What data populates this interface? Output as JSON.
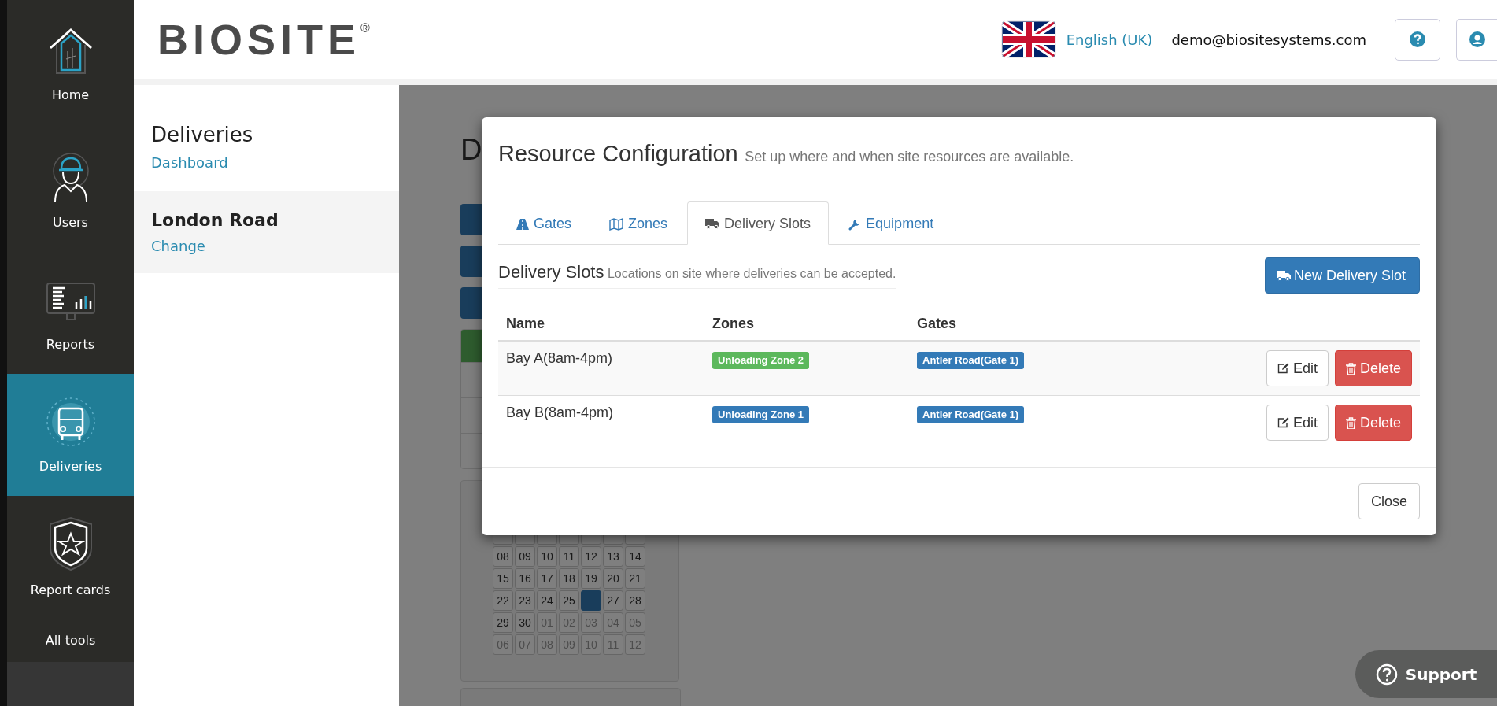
{
  "nav": [
    {
      "label": "Home",
      "selected": false
    },
    {
      "label": "Users",
      "selected": false
    },
    {
      "label": "Reports",
      "selected": false
    },
    {
      "label": "Deliveries",
      "selected": true
    },
    {
      "label": "Report cards",
      "selected": false
    },
    {
      "label": "All tools",
      "selected": false
    }
  ],
  "header": {
    "logo": "BIOSITE",
    "logo_mark": "®",
    "language": "English (UK)",
    "email": "demo@biositesystems.com"
  },
  "sidebar": {
    "title": "Deliveries",
    "link": "Dashboard",
    "site": "London Road",
    "site_link": "Change"
  },
  "background_page": {
    "heading": "D",
    "calendar_rows": [
      [
        {
          "selected": false
        },
        {
          "selected": false
        },
        {
          "selected": false
        },
        {
          "selected": false
        },
        {
          "selected": false
        },
        {
          "selected": false
        },
        {
          "selected": false
        }
      ],
      [
        {
          "day": "08",
          "muted": false,
          "selected": false
        },
        {
          "day": "09",
          "muted": false,
          "selected": false
        },
        {
          "day": "10",
          "muted": false,
          "selected": false
        },
        {
          "day": "11",
          "muted": false,
          "selected": false
        },
        {
          "day": "12",
          "muted": false,
          "selected": false
        },
        {
          "day": "13",
          "muted": false,
          "selected": false
        },
        {
          "day": "14",
          "muted": false,
          "selected": false
        }
      ],
      [
        {
          "day": "15",
          "muted": false,
          "selected": false
        },
        {
          "day": "16",
          "muted": false,
          "selected": false
        },
        {
          "day": "17",
          "muted": false,
          "selected": false
        },
        {
          "day": "18",
          "muted": false,
          "selected": false
        },
        {
          "day": "19",
          "muted": false,
          "selected": false
        },
        {
          "day": "20",
          "muted": false,
          "selected": false
        },
        {
          "day": "21",
          "muted": false,
          "selected": false
        }
      ],
      [
        {
          "day": "22",
          "muted": false,
          "selected": false
        },
        {
          "day": "23",
          "muted": false,
          "selected": false
        },
        {
          "day": "24",
          "muted": false,
          "selected": false
        },
        {
          "day": "25",
          "muted": false,
          "selected": false
        },
        {
          "selected": true
        },
        {
          "day": "27",
          "muted": false,
          "selected": false
        },
        {
          "day": "28",
          "muted": false,
          "selected": false
        }
      ],
      [
        {
          "day": "29",
          "muted": false,
          "selected": false
        },
        {
          "day": "30",
          "muted": false,
          "selected": false
        },
        {
          "day": "01",
          "muted": true,
          "selected": false
        },
        {
          "day": "02",
          "muted": true,
          "selected": false
        },
        {
          "day": "03",
          "muted": true,
          "selected": false
        },
        {
          "day": "04",
          "muted": true,
          "selected": false
        },
        {
          "day": "05",
          "muted": true,
          "selected": false
        }
      ],
      [
        {
          "day": "06",
          "muted": true,
          "selected": false
        },
        {
          "day": "07",
          "muted": true,
          "selected": false
        },
        {
          "day": "08",
          "muted": true,
          "selected": false
        },
        {
          "day": "09",
          "muted": true,
          "selected": false
        },
        {
          "day": "10",
          "muted": true,
          "selected": false
        },
        {
          "day": "11",
          "muted": true,
          "selected": false
        },
        {
          "day": "12",
          "muted": true,
          "selected": false
        }
      ]
    ]
  },
  "modal": {
    "title": "Resource Configuration",
    "subtitle": "Set up where and when site resources are available.",
    "tabs": [
      {
        "label": "Gates",
        "selected": false
      },
      {
        "label": "Zones",
        "selected": false
      },
      {
        "label": "Delivery Slots",
        "selected": true
      },
      {
        "label": "Equipment",
        "selected": false
      }
    ],
    "section_title": "Delivery Slots",
    "section_desc": "Locations on site where deliveries can be accepted.",
    "new_button": "New Delivery Slot",
    "columns": [
      "Name",
      "Zones",
      "Gates"
    ],
    "rows": [
      {
        "name": "Bay A(8am-4pm)",
        "zone": {
          "text": "Unloading Zone 2",
          "color": "#5cb85c"
        },
        "gate": {
          "text": "Antler Road(Gate 1)",
          "color": "#337ab7"
        },
        "edit": "Edit",
        "delete": "Delete"
      },
      {
        "name": "Bay B(8am-4pm)",
        "zone": {
          "text": "Unloading Zone 1",
          "color": "#337ab7"
        },
        "gate": {
          "text": "Antler Road(Gate 1)",
          "color": "#337ab7"
        },
        "edit": "Edit",
        "delete": "Delete"
      }
    ],
    "close": "Close"
  },
  "support": "Support"
}
